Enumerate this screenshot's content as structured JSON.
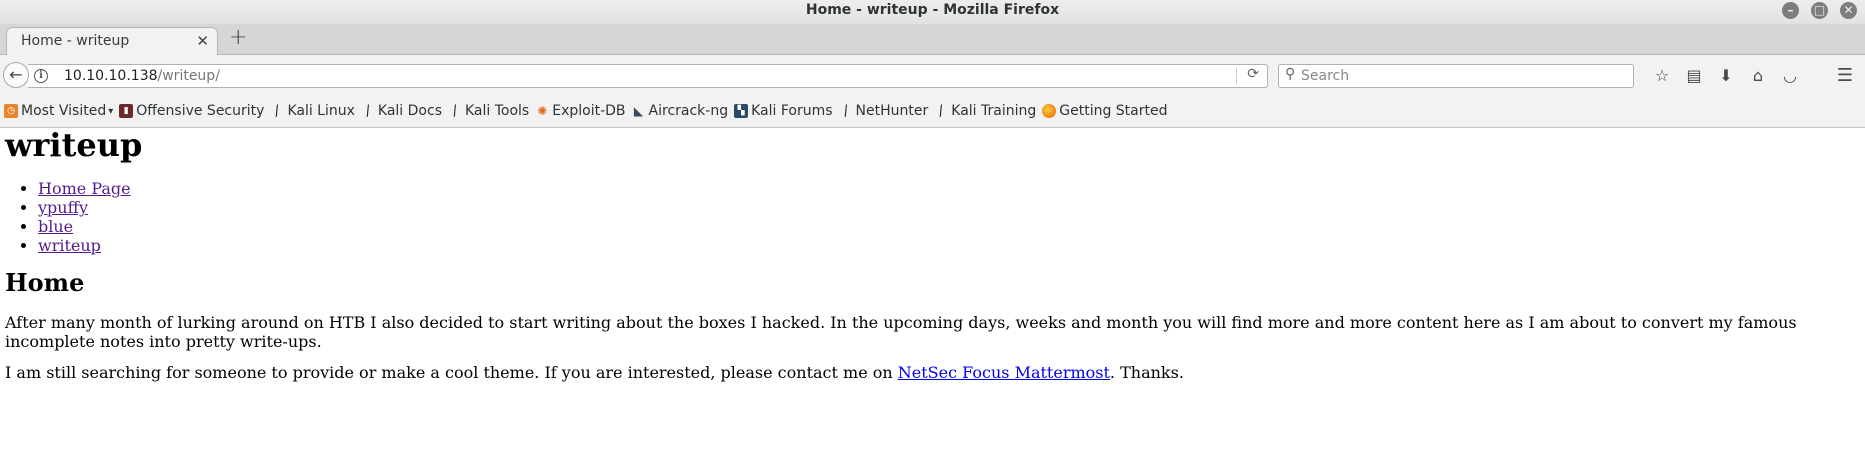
{
  "window": {
    "title": "Home - writeup - Mozilla Firefox",
    "controls": [
      "–",
      "□",
      "✕"
    ]
  },
  "tabs": [
    {
      "title": "Home - writeup",
      "close": "✕"
    }
  ],
  "new_tab_label": "+",
  "navbar": {
    "back": "←",
    "url_host": "10.10.10.138",
    "url_path": "/writeup/",
    "search_placeholder": "Search",
    "icons": [
      "star-icon",
      "reading-list-icon",
      "download-icon",
      "home-icon",
      "pocket-icon",
      "menu-icon"
    ]
  },
  "bookmarks": [
    {
      "label": "Most Visited",
      "icon": "most-visited-icon",
      "dropdown": true
    },
    {
      "label": "Offensive Security",
      "icon": "offsec-icon"
    },
    {
      "label": "Kali Linux",
      "icon": "kali-icon"
    },
    {
      "label": "Kali Docs",
      "icon": "kali-icon"
    },
    {
      "label": "Kali Tools",
      "icon": "kali-icon"
    },
    {
      "label": "Exploit-DB",
      "icon": "exploit-db-icon"
    },
    {
      "label": "Aircrack-ng",
      "icon": "aircrack-icon"
    },
    {
      "label": "Kali Forums",
      "icon": "kali-forums-icon"
    },
    {
      "label": "NetHunter",
      "icon": "kali-icon"
    },
    {
      "label": "Kali Training",
      "icon": "kali-icon"
    },
    {
      "label": "Getting Started",
      "icon": "firefox-icon"
    }
  ],
  "page": {
    "site_title": "writeup",
    "nav_links": [
      "Home Page",
      "ypuffy",
      "blue",
      "writeup"
    ],
    "heading": "Home",
    "paragraph1": "After many month of lurking around on HTB I also decided to start writing about the boxes I hacked. In the upcoming days, weeks and month you will find more and more content here as I am about to convert my famous incomplete notes into pretty write-ups.",
    "paragraph2_before": "I am still searching for someone to provide or make a cool theme. If you are interested, please contact me on ",
    "paragraph2_link": "NetSec Focus Mattermost",
    "paragraph2_after": ". Thanks."
  }
}
